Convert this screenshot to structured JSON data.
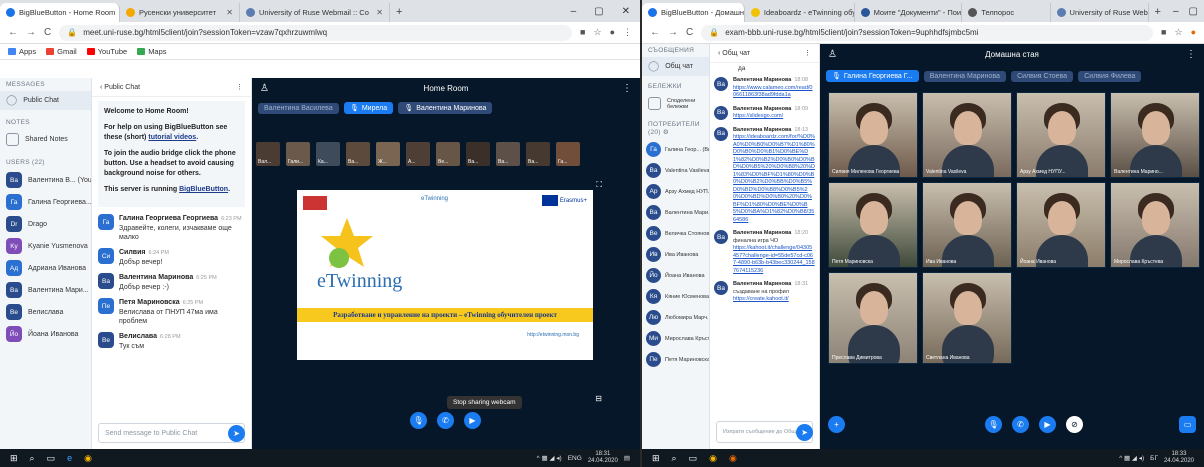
{
  "left": {
    "tabs": [
      {
        "title": "BigBlueButton - Home Room"
      },
      {
        "title": "Русенски университет"
      },
      {
        "title": "University of Ruse Webmail :: Co"
      }
    ],
    "url": "meet.uni-ruse.bg/html5client/join?sessionToken=vzaw7qxhrzuwmlwq",
    "bookmarks": [
      "Apps",
      "Gmail",
      "YouTube",
      "Maps"
    ],
    "sidebar": {
      "messages_header": "MESSAGES",
      "public_chat": "Public Chat",
      "notes_header": "NOTES",
      "shared_notes": "Shared Notes",
      "users_header": "USERS (22)",
      "users": [
        {
          "initials": "Ва",
          "name": "Валентина В... (You)",
          "color": "#2b4c8c"
        },
        {
          "initials": "Га",
          "name": "Галина Георгиева...",
          "color": "#2b6fd1"
        },
        {
          "initials": "Dr",
          "name": "Drago",
          "color": "#2b4c8c"
        },
        {
          "initials": "Ky",
          "name": "Kyanie Yusmenova",
          "color": "#7e4db8"
        },
        {
          "initials": "Ад",
          "name": "Адриана Иванова",
          "color": "#2b6fd1"
        },
        {
          "initials": "Ва",
          "name": "Валентина Мари...",
          "color": "#2b4c8c"
        },
        {
          "initials": "Ве",
          "name": "Велислава",
          "color": "#2b4c8c"
        },
        {
          "initials": "Йо",
          "name": "Йоана Иванова",
          "color": "#7e4db8"
        }
      ]
    },
    "chat": {
      "back_label": "Public Chat",
      "welcome_title": "Welcome to Home Room!",
      "welcome_help": "For help on using BigBlueButton see these (short)",
      "welcome_link": "tutorial videos",
      "welcome_audio": "To join the audio bridge click the phone button. Use a headset to avoid causing background noise for others.",
      "welcome_server": "This server is running",
      "welcome_server_link": "BigBlueButton",
      "messages": [
        {
          "initials": "Га",
          "color": "#2b6fd1",
          "name": "Галина Георгиева Георгиева",
          "time": "6:23 PM",
          "text": "Здравейте, колеги, изчакваме още малко"
        },
        {
          "initials": "Си",
          "color": "#2b6fd1",
          "name": "Силвия",
          "time": "6:24 PM",
          "text": "Добър вечер!"
        },
        {
          "initials": "Ва",
          "color": "#2b4c8c",
          "name": "Валентина Маринова",
          "time": "6:25 PM",
          "text": "Добър вечер :-)"
        },
        {
          "initials": "Пе",
          "color": "#2b6fd1",
          "name": "Петя Мариновска",
          "time": "6:25 PM",
          "text": "Велислава от ПНУП 47ма има проблем"
        },
        {
          "initials": "Ве",
          "color": "#2b4c8c",
          "name": "Велислава",
          "time": "6:28 PM",
          "text": "Тук съм"
        }
      ],
      "input_placeholder": "Send message to Public Chat"
    },
    "main": {
      "room_title": "Home Room",
      "talkers": [
        "Валентина Василева",
        "Мирела",
        "Валентина Маринова"
      ],
      "thumbs": [
        "Вал...",
        "Гали...",
        "Ка...",
        "Ва...",
        "Ж...",
        "А...",
        "Ве...",
        "Ва...",
        "Ва...",
        "Ва...",
        "Га..."
      ],
      "slide_title": "Разработване и управление на проекти – eTwinning обучителен проект",
      "slide_logo": "eTwinning",
      "slide_url": "http://etwinning.mon.bg",
      "slide_erasmus": "Erasmus+",
      "tooltip": "Stop sharing webcam"
    },
    "clock_time": "18:31",
    "clock_date": "24.04.2020",
    "tray_lang": "ENG"
  },
  "right": {
    "tabs": [
      {
        "title": "BigBlueButton - Домашна"
      },
      {
        "title": "Ideaboardz - eTwinning обучен"
      },
      {
        "title": "Моите \"Документи\" - Поиграни"
      },
      {
        "title": "Телпорос"
      },
      {
        "title": "University of Ruse Webmail :: ку"
      }
    ],
    "url": "exam-bbb.uni-ruse.bg/html5client/join?sessionToken=9uphhdfsjmbc5mi",
    "sidebar": {
      "messages_header": "СЪОБЩЕНИЯ",
      "public_chat": "Общ чат",
      "notes_header": "БЕЛЕЖКИ",
      "shared_notes": "Споделени бележки",
      "users_header": "ПОТРЕБИТЕЛИ (20)",
      "users": [
        {
          "initials": "Га",
          "name": "Галина Геор... (Вие)",
          "color": "#2b6fd1"
        },
        {
          "initials": "Ва",
          "name": "Valentina Vasileva",
          "color": "#2b4c8c"
        },
        {
          "initials": "Ар",
          "name": "Арзу Ахмед НУП...",
          "color": "#2b4c8c"
        },
        {
          "initials": "Ва",
          "name": "Валентина Мари...",
          "color": "#2b4c8c"
        },
        {
          "initials": "Ве",
          "name": "Величка Стоянова",
          "color": "#2b4c8c"
        },
        {
          "initials": "Ив",
          "name": "Ива Иванова",
          "color": "#2b4c8c"
        },
        {
          "initials": "Йо",
          "name": "Йоана Иванова",
          "color": "#2b4c8c"
        },
        {
          "initials": "Кя",
          "name": "Кяние Юсменова",
          "color": "#2b4c8c"
        },
        {
          "initials": "Лю",
          "name": "Любомира Марч...",
          "color": "#2b4c8c"
        },
        {
          "initials": "Ми",
          "name": "Мирослава Кръст...",
          "color": "#2b4c8c"
        },
        {
          "initials": "Пе",
          "name": "Петя Мариновска",
          "color": "#2b4c8c"
        }
      ]
    },
    "chat": {
      "back_label": "Общ чат",
      "first_text": "да",
      "messages": [
        {
          "initials": "Ва",
          "name": "Валентина Маринова",
          "time": "18:08",
          "text": "",
          "link": "https://www.calameo.com/read/006611863f38ad9fdda1a"
        },
        {
          "initials": "Ва",
          "name": "Валентина Маринова",
          "time": "18:09",
          "text": "",
          "link": "https://slidesgo.com/"
        },
        {
          "initials": "Ва",
          "name": "Валентина Маринова",
          "time": "18:13",
          "text": "",
          "link": "https://ideaboardz.com/for/%D0%A0%D0%B0%D0%B7%D1%80%D0%B0%D0%B1%D0%BE%D1%82%D0%B2%D0%B0%D0%BD%D0%B5%20%D0%B8%20%D1%83%D0%BF%D1%80%D0%B0%D0%B2%D0%BB%D0%B5%D0%BD%D0%B8%D0%B5%20%D0%BD%D0%B0%20%D0%BF%D1%80%D0%BE%D0%B5%D0%BA%D1%82%D0%B8/3564586"
        },
        {
          "initials": "Ва",
          "name": "Валентина Маринова",
          "time": "18:20",
          "text": "финална игра ЧО",
          "link": "https://kahoot.it/challenge/04305457?challenge-id=55de57cd-c067-4890-b63b-b43bec330244_1587674115236"
        },
        {
          "initials": "Ва",
          "name": "Валентина Маринова",
          "time": "18:31",
          "text": "създаване на профил",
          "link": "https://create.kahoot.it/"
        }
      ],
      "input_placeholder": "Изпрати съобщение до Общ чат"
    },
    "main": {
      "room_title": "Домашна стая",
      "talkers": [
        "Галина Георгиева Г...",
        "Валентина Маринова",
        "Силвия Стоева",
        "Силвия Филева"
      ],
      "tiles": [
        {
          "label": "Силвия Миленова Георгиева",
          "tone": "#6e5a4a"
        },
        {
          "label": "Valentina Vasileva",
          "tone": "#7a6a5e"
        },
        {
          "label": "Арзу Ахмед НУПУ...",
          "tone": "#8a7b6c"
        },
        {
          "label": "Валентина Марино...",
          "tone": "#5b4f45"
        },
        {
          "label": "Петя Мариновска",
          "tone": "#3f4a3a"
        },
        {
          "label": "Ива Иванова",
          "tone": "#6d6152"
        },
        {
          "label": "Йоана Иванова",
          "tone": "#8c7d6a"
        },
        {
          "label": "Мирослава Кръстева",
          "tone": "#85796e"
        },
        {
          "label": "Преслава Димитрова",
          "tone": "#8d8377"
        },
        {
          "label": "Светлана Иванова",
          "tone": "#776a5a"
        }
      ]
    },
    "clock_time": "18:33",
    "clock_date": "24.04.2020",
    "tray_lang": "БГ"
  }
}
